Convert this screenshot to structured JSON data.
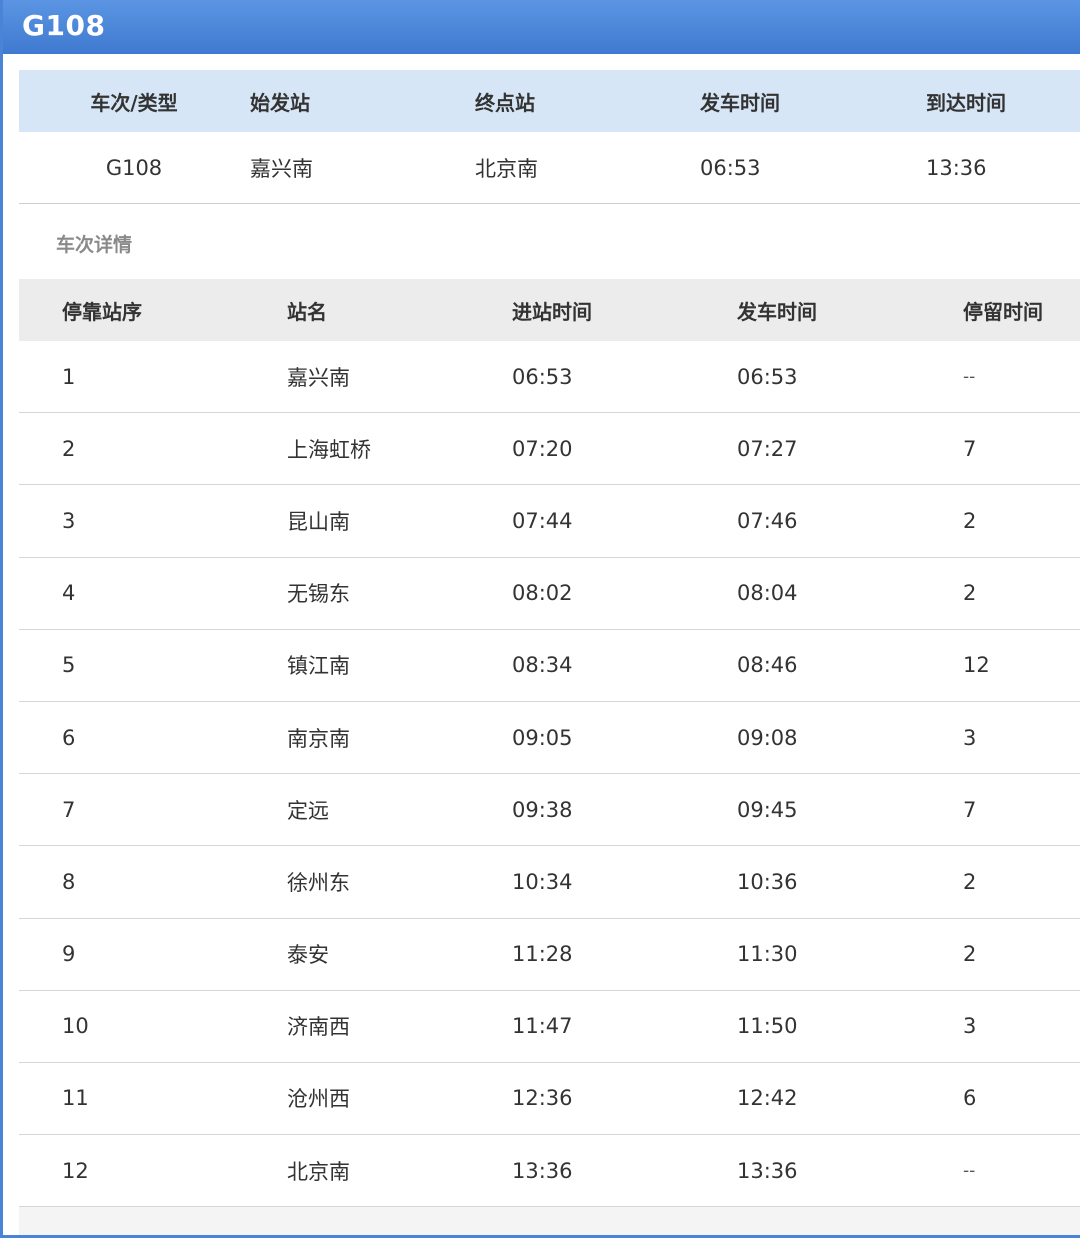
{
  "window": {
    "title": "G108"
  },
  "summary": {
    "headers": [
      "车次/类型",
      "始发站",
      "终点站",
      "发车时间",
      "到达时间"
    ],
    "values": [
      "G108",
      "嘉兴南",
      "北京南",
      "06:53",
      "13:36"
    ]
  },
  "section_label": "车次详情",
  "details": {
    "headers": [
      "停靠站序",
      "站名",
      "进站时间",
      "发车时间",
      "停留时间"
    ],
    "rows": [
      [
        "1",
        "嘉兴南",
        "06:53",
        "06:53",
        "--"
      ],
      [
        "2",
        "上海虹桥",
        "07:20",
        "07:27",
        "7"
      ],
      [
        "3",
        "昆山南",
        "07:44",
        "07:46",
        "2"
      ],
      [
        "4",
        "无锡东",
        "08:02",
        "08:04",
        "2"
      ],
      [
        "5",
        "镇江南",
        "08:34",
        "08:46",
        "12"
      ],
      [
        "6",
        "南京南",
        "09:05",
        "09:08",
        "3"
      ],
      [
        "7",
        "定远",
        "09:38",
        "09:45",
        "7"
      ],
      [
        "8",
        "徐州东",
        "10:34",
        "10:36",
        "2"
      ],
      [
        "9",
        "泰安",
        "11:28",
        "11:30",
        "2"
      ],
      [
        "10",
        "济南西",
        "11:47",
        "11:50",
        "3"
      ],
      [
        "11",
        "沧州西",
        "12:36",
        "12:42",
        "6"
      ],
      [
        "12",
        "北京南",
        "13:36",
        "13:36",
        "--"
      ]
    ]
  },
  "colors": {
    "titlebar": "#4a84d6",
    "summary_header_bg": "#d7e6f6",
    "detail_header_bg": "#ececec",
    "row_divider": "#d6d6d6"
  }
}
